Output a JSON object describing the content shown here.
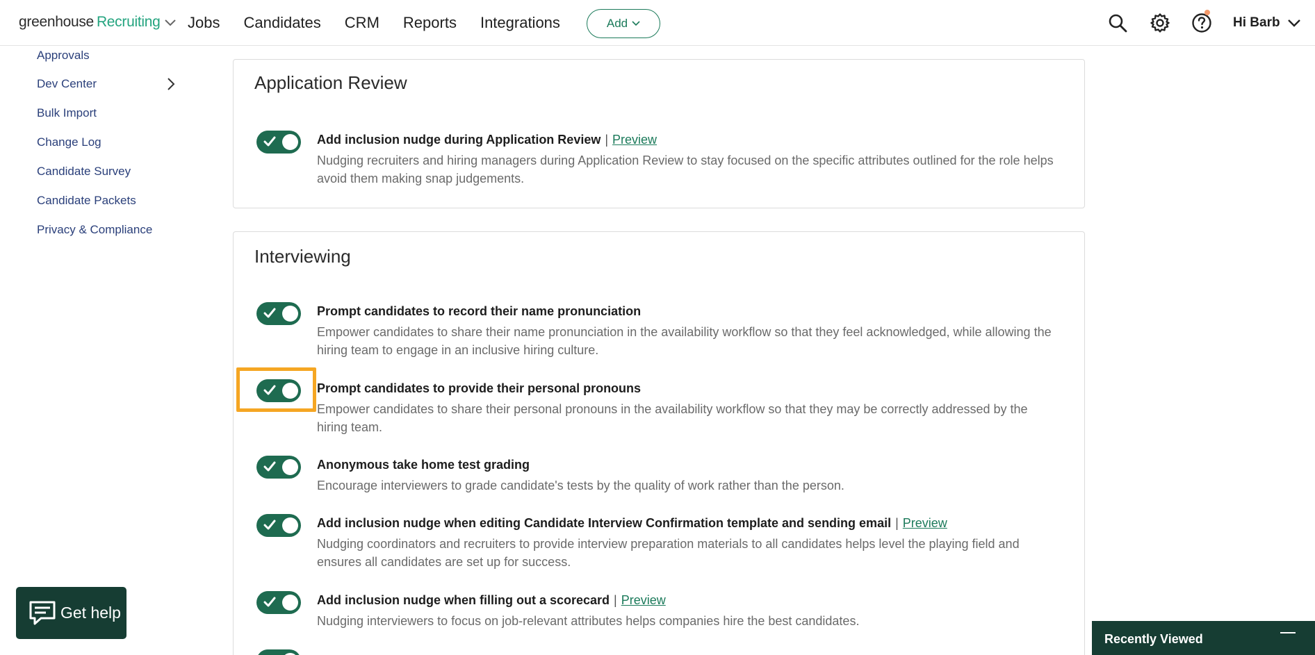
{
  "nav": {
    "brand_primary": "greenhouse",
    "brand_secondary": "Recruiting",
    "links": [
      "Jobs",
      "Candidates",
      "CRM",
      "Reports",
      "Integrations"
    ],
    "add_label": "Add",
    "user_label": "Hi Barb",
    "icons": [
      "search-icon",
      "gear-icon",
      "help-icon"
    ],
    "notification_dot_color": "#f49a6b"
  },
  "sidebar": {
    "items": [
      "Approvals",
      "Dev Center",
      "Bulk Import",
      "Change Log",
      "Candidate Survey",
      "Candidate Packets",
      "Privacy & Compliance"
    ]
  },
  "sections": [
    {
      "title": "Application Review",
      "settings": [
        {
          "title": "Add inclusion nudge during Application Review",
          "link": "Preview",
          "description": "Nudging recruiters and hiring managers during Application Review to stay focused on the specific attributes outlined for the role helps avoid them making snap judgements.",
          "enabled": true
        }
      ]
    },
    {
      "title": "Interviewing",
      "settings": [
        {
          "title": "Prompt candidates to record their name pronunciation",
          "link": "",
          "description": "Empower candidates to share their name pronunciation in the availability workflow so that they feel acknowledged, while allowing the hiring team to engage in an inclusive hiring culture.",
          "enabled": true
        },
        {
          "title": "Prompt candidates to provide their personal pronouns",
          "link": "",
          "description": "Empower candidates to share their personal pronouns in the availability workflow so that they may be correctly addressed by the hiring team.",
          "enabled": true
        },
        {
          "title": "Anonymous take home test grading",
          "link": "",
          "description": "Encourage interviewers to grade candidate's tests by the quality of work rather than the person.",
          "enabled": true
        },
        {
          "title": "Add inclusion nudge when editing Candidate Interview Confirmation template and sending email",
          "link": "Preview",
          "description": "Nudging coordinators and recruiters to provide interview preparation materials to all candidates helps level the playing field and ensures all candidates are set up for success.",
          "enabled": true
        },
        {
          "title": "Add inclusion nudge when filling out a scorecard",
          "link": "Preview",
          "description": "Nudging interviewers to focus on job-relevant attributes helps companies hire the best candidates.",
          "enabled": true
        }
      ]
    }
  ],
  "widgets": {
    "get_help_label": "Get help",
    "recently_viewed_label": "Recently Viewed"
  },
  "colors": {
    "brand_green": "#24a47f",
    "toggle_on": "#1e6b50",
    "highlight": "#f5a623",
    "widget_bg": "#163d33",
    "sidebar_link": "#2a3f7a"
  }
}
